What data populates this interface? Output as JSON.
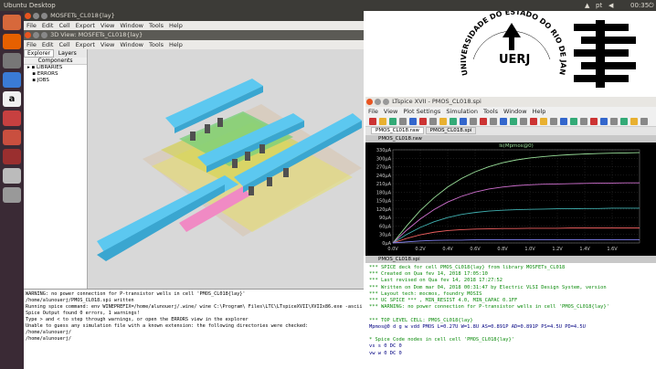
{
  "topbar": {
    "title": "Ubuntu Desktop",
    "time": "00:35",
    "lang": "pt"
  },
  "launcher": [
    {
      "icon": "home-folder-icon",
      "color": "#d7683b",
      "glyph": ""
    },
    {
      "icon": "firefox-icon",
      "color": "#e66000",
      "glyph": ""
    },
    {
      "icon": "files-icon",
      "color": "#777",
      "glyph": ""
    },
    {
      "icon": "libreoffice-icon",
      "color": "#3a7bd5",
      "glyph": ""
    },
    {
      "icon": "amazon-icon",
      "color": "#f0f0f0",
      "glyph": "a"
    },
    {
      "icon": "settings-icon",
      "color": "#c74040",
      "glyph": ""
    },
    {
      "icon": "ubuntu-one-icon",
      "color": "#c94f3f",
      "glyph": ""
    },
    {
      "icon": "electric-icon",
      "color": "#9a2f2f",
      "glyph": ""
    },
    {
      "icon": "drive-icon",
      "color": "#bbb",
      "glyph": ""
    },
    {
      "icon": "drive2-icon",
      "color": "#999",
      "glyph": ""
    }
  ],
  "electric": {
    "title": "MOSFETs_CL018{lay}",
    "menu": [
      "File",
      "Edit",
      "Cell",
      "Export",
      "View",
      "Window",
      "Tools",
      "Help"
    ],
    "inner_title": "3D View: MOSFETs_CL018{lay}",
    "inner_menu": [
      "File",
      "Edit",
      "Cell",
      "Export",
      "View",
      "Window",
      "Tools",
      "Help"
    ],
    "tabs": [
      "Explorer",
      "Layers"
    ],
    "tree_header": "Components",
    "tree": [
      "LIBRARIES",
      "ERRORS",
      "JOBS"
    ]
  },
  "messages": [
    "WARNING: no power connection for P-transistor wells in cell 'PMOS_CL018{lay}'",
    " /home/alunouerj/PMOS_CL018.spi written",
    "Running spice command: env WINEPREFIX=/home/alunouerj/.wine/ wine C:\\Program\\ Files\\LTC\\LTspiceXVII\\XVIIx86.exe -ascii -b PMOS_CL018.spi -r PM",
    "Spice Output found 0 errors, 1 warnings!",
    "Type > and < to step through warnings, or open the ERRORS view in the explorer",
    "Unable to guess any simulation file with a known extension: the following directories were checked:",
    "  /home/alunouerj/",
    "  /home/alunouerj/"
  ],
  "ltspice": {
    "title": "LTspice XVII - PMOS_CL018.spi",
    "menu": [
      "File",
      "View",
      "Plot Settings",
      "Simulation",
      "Tools",
      "Window",
      "Help"
    ],
    "tabs": [
      "PMOS_CL018.raw",
      "PMOS_CL018.spi"
    ],
    "plot_title_bar": "PMOS_CL018.raw",
    "spi_title_bar": "PMOS_CL018.spi",
    "spice_lines": [
      {
        "t": "*** SPICE deck for cell PMOS_CL018{lay} from library MOSFETs_CL018",
        "c": "#0a8a0a"
      },
      {
        "t": "*** Created on Qua fev 14, 2018 17:05:10",
        "c": "#0a8a0a"
      },
      {
        "t": "*** Last revised on Qua fev 14, 2018 17:27:52",
        "c": "#0a8a0a"
      },
      {
        "t": "*** Written on Dom mar 04, 2018 00:31:47 by Electric VLSI Design System, version",
        "c": "#0a8a0a"
      },
      {
        "t": "*** Layout tech: mocmos, foundry MOSIS",
        "c": "#0a8a0a"
      },
      {
        "t": "*** UC SPICE *** , MIN_RESIST 4.0, MIN_CAPAC 0.1FF",
        "c": "#0a8a0a"
      },
      {
        "t": "*** WARNING: no power connection for P-transistor wells in cell 'PMOS_CL018{lay}'",
        "c": "#0a8a0a"
      },
      {
        "t": "",
        "c": "#000"
      },
      {
        "t": "*** TOP LEVEL CELL: PMOS_CL018{lay}",
        "c": "#0a8a0a"
      },
      {
        "t": "Mpmos@0 d g w vdd PMOS L=0.27U W=1.8U AS=0.891P AD=0.891P PS=4.5U PD=4.5U",
        "c": "#000080"
      },
      {
        "t": "",
        "c": "#000"
      },
      {
        "t": "* Spice Code nodes in cell cell 'PMOS_CL018{lay}'",
        "c": "#0a8a0a"
      },
      {
        "t": "vs s 0 DC 0",
        "c": "#000080"
      },
      {
        "t": "vw w 0 DC 0",
        "c": "#000080"
      }
    ]
  },
  "chart_data": {
    "type": "line",
    "title": "Is(Mpmos@0)",
    "y_tick_labels": [
      "330µA",
      "300µA",
      "270µA",
      "240µA",
      "210µA",
      "180µA",
      "150µA",
      "120µA",
      "90µA",
      "60µA",
      "30µA",
      "0µA"
    ],
    "x_tick_labels": [
      "0.0V",
      "0.2V",
      "0.4V",
      "0.6V",
      "0.8V",
      "1.0V",
      "1.2V",
      "1.4V",
      "1.6V"
    ],
    "x": [
      0,
      0.1,
      0.2,
      0.3,
      0.4,
      0.5,
      0.6,
      0.7,
      0.8,
      0.9,
      1.0,
      1.1,
      1.2,
      1.3,
      1.4,
      1.5,
      1.6,
      1.7,
      1.8
    ],
    "ylim": [
      0,
      330
    ],
    "xlim": [
      0,
      1.8
    ],
    "series": [
      {
        "color": "#9ae09a",
        "values": [
          0,
          60,
          115,
          160,
          198,
          228,
          252,
          270,
          284,
          294,
          301,
          306,
          310,
          313,
          315,
          317,
          318,
          319,
          320
        ]
      },
      {
        "color": "#d070d0",
        "values": [
          0,
          45,
          85,
          118,
          145,
          165,
          180,
          191,
          198,
          203,
          206,
          208,
          209,
          210,
          211,
          212,
          212,
          213,
          213
        ]
      },
      {
        "color": "#40b0b0",
        "values": [
          0,
          30,
          55,
          75,
          90,
          101,
          108,
          113,
          116,
          118,
          119,
          120,
          121,
          121,
          122,
          122,
          123,
          123,
          123
        ]
      },
      {
        "color": "#f06060",
        "values": [
          0,
          16,
          29,
          38,
          44,
          47,
          49,
          50,
          51,
          51,
          52,
          52,
          52,
          53,
          53,
          53,
          53,
          53,
          53
        ]
      },
      {
        "color": "#8080f0",
        "values": [
          0,
          4,
          7,
          9,
          10,
          10,
          11,
          11,
          11,
          11,
          11,
          11,
          11,
          11,
          11,
          11,
          11,
          11,
          11
        ]
      }
    ]
  },
  "logos": {
    "uerj_text": "UERJ",
    "uerj_arc": "UNIVERSIDADE DO ESTADO DO RIO DE JANEIRO"
  }
}
